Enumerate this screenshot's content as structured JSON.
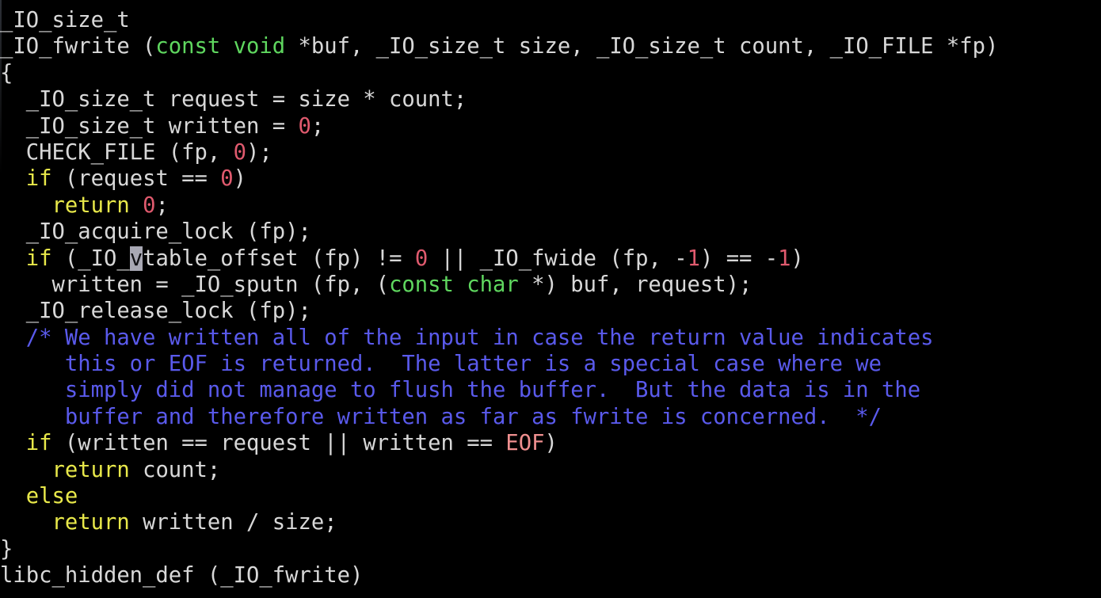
{
  "app": {
    "kind": "terminal-text-editor",
    "background_color": "#000000",
    "foreground_color": "#d8d8d8",
    "language": "C"
  },
  "theme": {
    "plain": "#d8d8d8",
    "keyword": "#e8e84a",
    "type": "#5fd75f",
    "number": "#e05a6e",
    "constant": "#ef8f8f",
    "comment": "#5a5aec",
    "cursor_background": "#a8a8b4",
    "cursor_foreground": "#101014"
  },
  "cursor": {
    "character": "v",
    "line_index": 9,
    "column": 7,
    "on_token": "_IO_vtable_offset"
  },
  "code": {
    "lines": [
      {
        "id": 1,
        "text": "_IO_size_t"
      },
      {
        "id": 2,
        "text": "_IO_fwrite (const void *buf, _IO_size_t size, _IO_size_t count, _IO_FILE *fp)"
      },
      {
        "id": 3,
        "text": "{"
      },
      {
        "id": 4,
        "text": "  _IO_size_t request = size * count;"
      },
      {
        "id": 5,
        "text": "  _IO_size_t written = 0;"
      },
      {
        "id": 6,
        "text": "  CHECK_FILE (fp, 0);"
      },
      {
        "id": 7,
        "text": "  if (request == 0)"
      },
      {
        "id": 8,
        "text": "    return 0;"
      },
      {
        "id": 9,
        "text": "  _IO_acquire_lock (fp);"
      },
      {
        "id": 10,
        "text": "  if (_IO_vtable_offset (fp) != 0 || _IO_fwide (fp, -1) == -1)"
      },
      {
        "id": 11,
        "text": "    written = _IO_sputn (fp, (const char *) buf, request);"
      },
      {
        "id": 12,
        "text": "  _IO_release_lock (fp);"
      },
      {
        "id": 13,
        "text": "  /* We have written all of the input in case the return value indicates"
      },
      {
        "id": 14,
        "text": "     this or EOF is returned.  The latter is a special case where we"
      },
      {
        "id": 15,
        "text": "     simply did not manage to flush the buffer.  But the data is in the"
      },
      {
        "id": 16,
        "text": "     buffer and therefore written as far as fwrite is concerned.  */"
      },
      {
        "id": 17,
        "text": "  if (written == request || written == EOF)"
      },
      {
        "id": 18,
        "text": "    return count;"
      },
      {
        "id": 19,
        "text": "  else"
      },
      {
        "id": 20,
        "text": "    return written / size;"
      },
      {
        "id": 21,
        "text": "}"
      },
      {
        "id": 22,
        "text": "libc_hidden_def (_IO_fwrite)"
      }
    ]
  },
  "tokens": {
    "line1": [
      {
        "t": "_IO_size_t",
        "c": "plain"
      }
    ],
    "line2": [
      {
        "t": "_IO_fwrite (",
        "c": "plain"
      },
      {
        "t": "const void",
        "c": "type"
      },
      {
        "t": " *buf, _IO_size_t size, _IO_size_t count, _IO_FILE *fp)",
        "c": "plain"
      }
    ],
    "line3": [
      {
        "t": "{",
        "c": "plain"
      }
    ],
    "line4": [
      {
        "t": "  _IO_size_t request = size * count;",
        "c": "plain"
      }
    ],
    "line5": [
      {
        "t": "  _IO_size_t written = ",
        "c": "plain"
      },
      {
        "t": "0",
        "c": "number"
      },
      {
        "t": ";",
        "c": "plain"
      }
    ],
    "line6": [
      {
        "t": "  CHECK_FILE (fp, ",
        "c": "plain"
      },
      {
        "t": "0",
        "c": "number"
      },
      {
        "t": ");",
        "c": "plain"
      }
    ],
    "line7": [
      {
        "t": "  ",
        "c": "plain"
      },
      {
        "t": "if",
        "c": "keyword"
      },
      {
        "t": " (request == ",
        "c": "plain"
      },
      {
        "t": "0",
        "c": "number"
      },
      {
        "t": ")",
        "c": "plain"
      }
    ],
    "line8": [
      {
        "t": "    ",
        "c": "plain"
      },
      {
        "t": "return",
        "c": "keyword"
      },
      {
        "t": " ",
        "c": "plain"
      },
      {
        "t": "0",
        "c": "number"
      },
      {
        "t": ";",
        "c": "plain"
      }
    ],
    "line9": [
      {
        "t": "  _IO_acquire_lock (fp);",
        "c": "plain"
      }
    ],
    "line10": [
      {
        "t": "  ",
        "c": "plain"
      },
      {
        "t": "if",
        "c": "keyword"
      },
      {
        "t": " (_IO_",
        "c": "plain"
      },
      {
        "t": "v",
        "c": "cursor"
      },
      {
        "t": "table_offset (fp) != ",
        "c": "plain"
      },
      {
        "t": "0",
        "c": "number"
      },
      {
        "t": " || _IO_fwide (fp, -",
        "c": "plain"
      },
      {
        "t": "1",
        "c": "number"
      },
      {
        "t": ") == -",
        "c": "plain"
      },
      {
        "t": "1",
        "c": "number"
      },
      {
        "t": ")",
        "c": "plain"
      }
    ],
    "line11": [
      {
        "t": "    written = _IO_sputn (fp, (",
        "c": "plain"
      },
      {
        "t": "const char",
        "c": "type"
      },
      {
        "t": " *) buf, request);",
        "c": "plain"
      }
    ],
    "line12": [
      {
        "t": "  _IO_release_lock (fp);",
        "c": "plain"
      }
    ],
    "line13": [
      {
        "t": "  /* We have written all of the input in case the return value indicates",
        "c": "comment"
      }
    ],
    "line14": [
      {
        "t": "     this or EOF is returned.  The latter is a special case where we",
        "c": "comment"
      }
    ],
    "line15": [
      {
        "t": "     simply did not manage to flush the buffer.  But the data is in the",
        "c": "comment"
      }
    ],
    "line16": [
      {
        "t": "     buffer and therefore written as far as fwrite is concerned.  */",
        "c": "comment"
      }
    ],
    "line17": [
      {
        "t": "  ",
        "c": "plain"
      },
      {
        "t": "if",
        "c": "keyword"
      },
      {
        "t": " (written == request || written == ",
        "c": "plain"
      },
      {
        "t": "EOF",
        "c": "const"
      },
      {
        "t": ")",
        "c": "plain"
      }
    ],
    "line18": [
      {
        "t": "    ",
        "c": "plain"
      },
      {
        "t": "return",
        "c": "keyword"
      },
      {
        "t": " count;",
        "c": "plain"
      }
    ],
    "line19": [
      {
        "t": "  ",
        "c": "plain"
      },
      {
        "t": "else",
        "c": "keyword"
      }
    ],
    "line20": [
      {
        "t": "    ",
        "c": "plain"
      },
      {
        "t": "return",
        "c": "keyword"
      },
      {
        "t": " written / size;",
        "c": "plain"
      }
    ],
    "line21": [
      {
        "t": "}",
        "c": "plain"
      }
    ],
    "line22": [
      {
        "t": "libc_hidden_def (_IO_fwrite)",
        "c": "plain"
      }
    ]
  }
}
